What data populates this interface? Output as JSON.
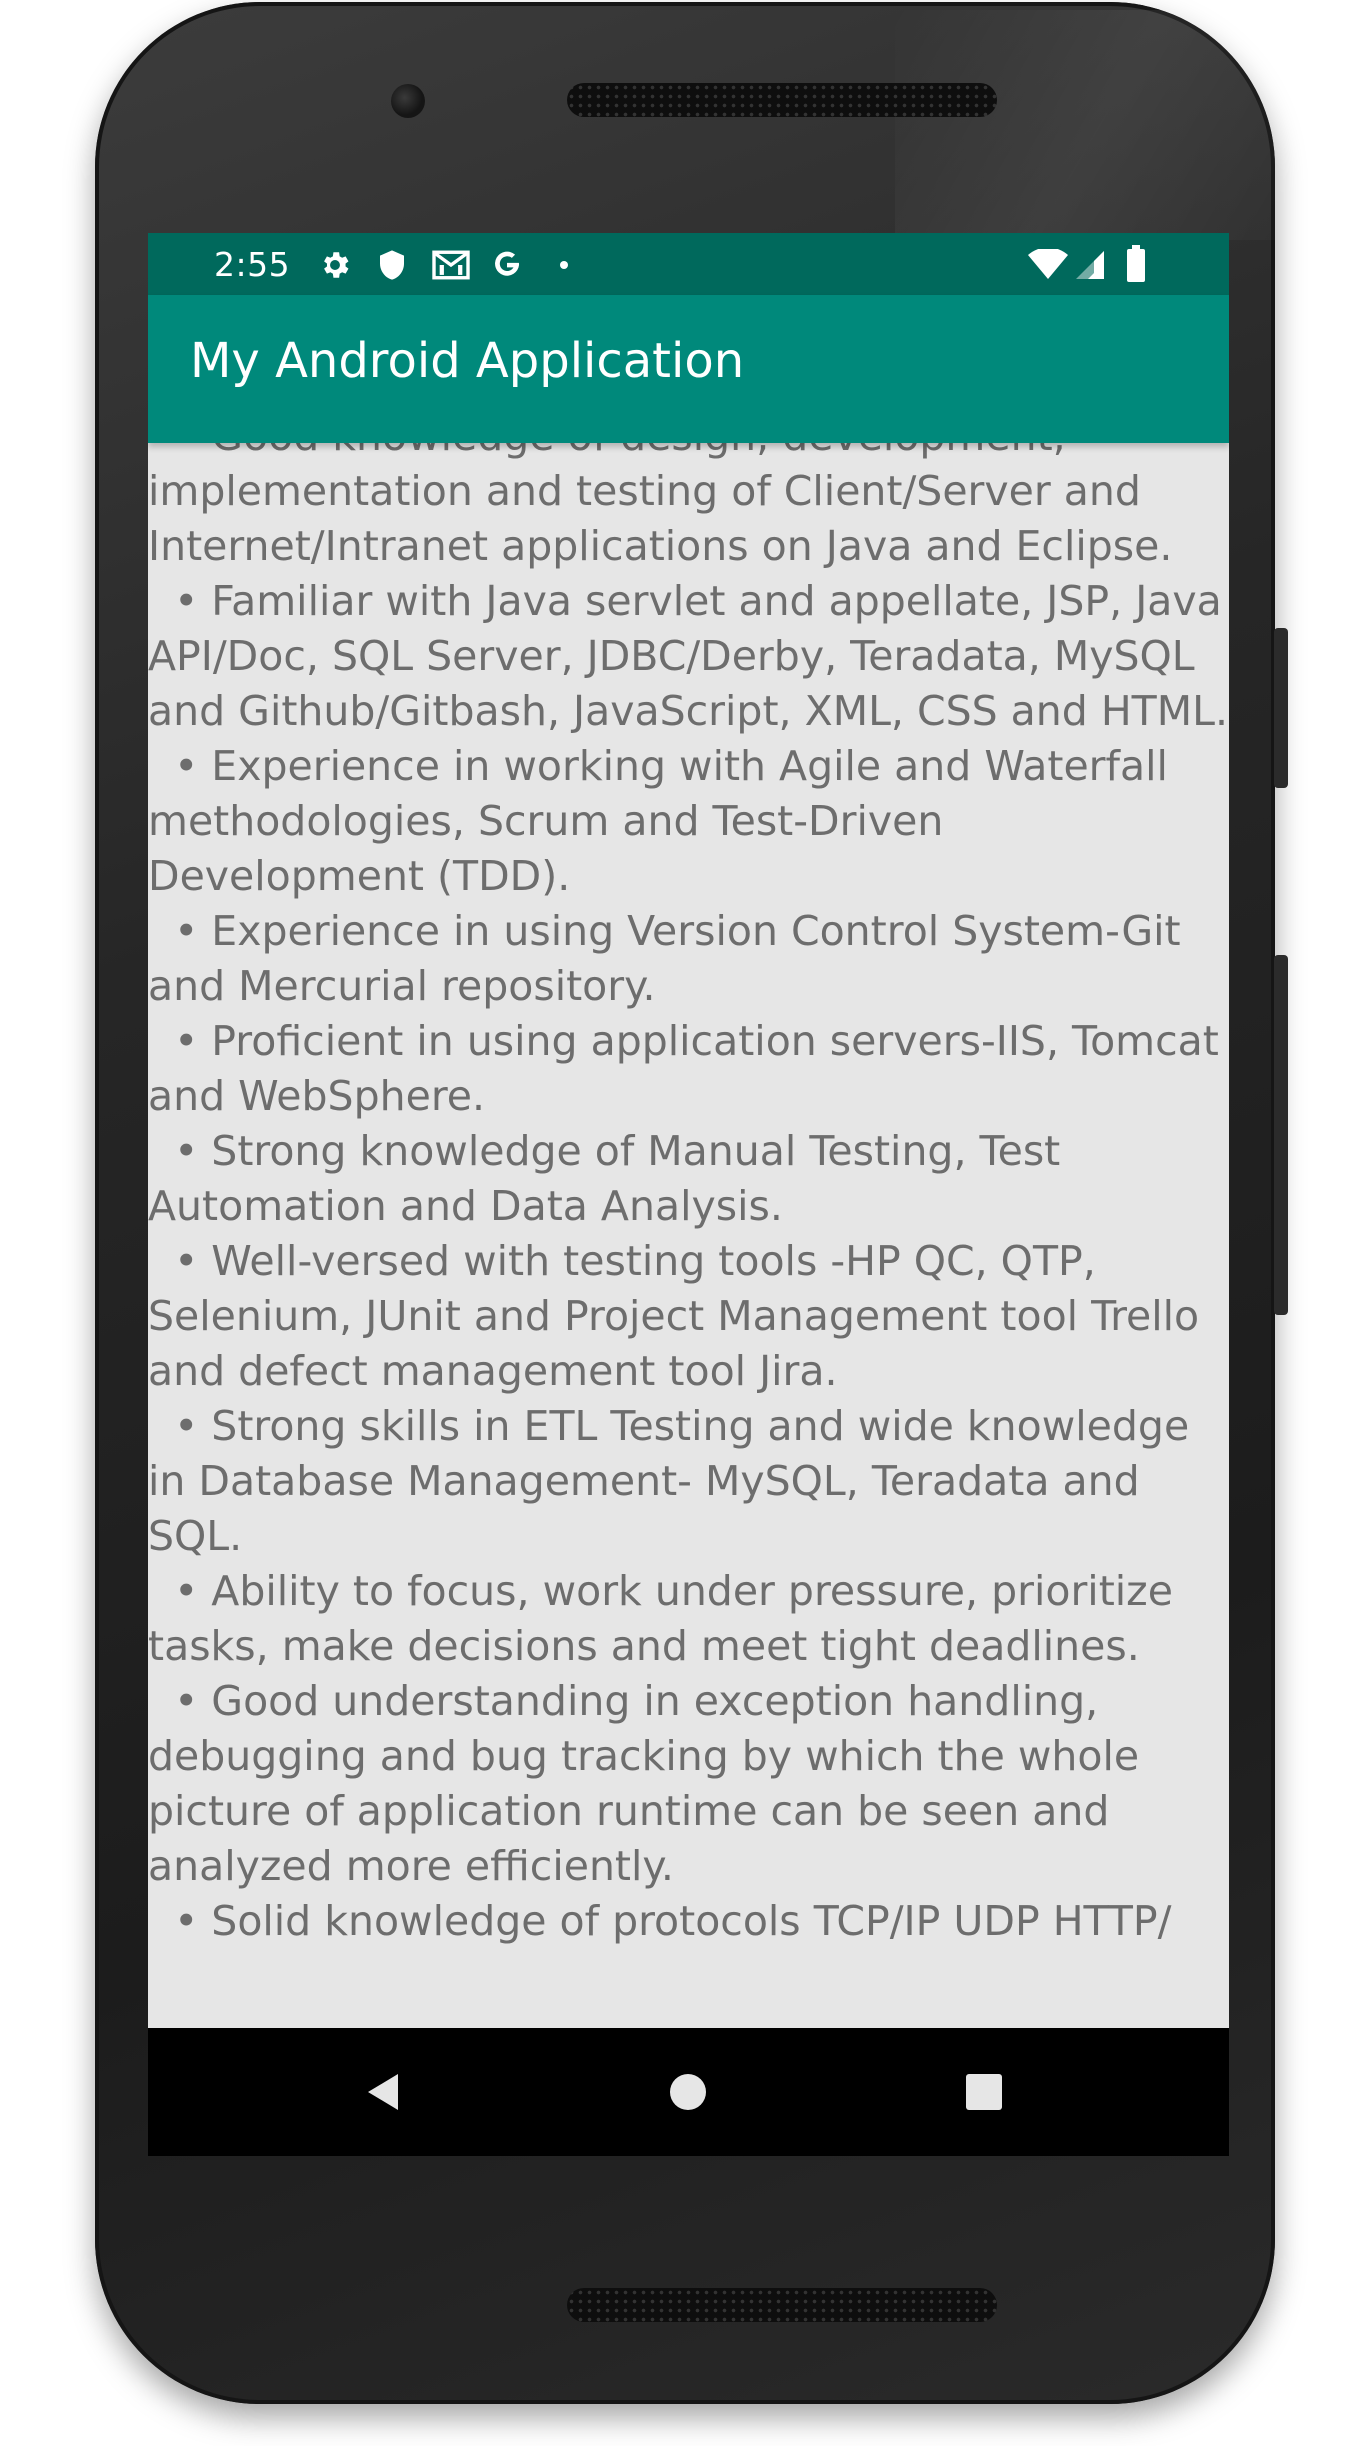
{
  "status_bar": {
    "time": "2:55",
    "left_icons": [
      "gear-icon",
      "shield-icon",
      "mail-icon",
      "google-icon",
      "dot-icon"
    ],
    "right_icons": [
      "wifi-icon",
      "cell-signal-icon",
      "battery-icon"
    ],
    "background_color": "#00695c"
  },
  "app_bar": {
    "title": "My Android Application",
    "background_color": "#00897b"
  },
  "content": {
    "background_color": "#e6e6e6",
    "text_color": "#6d6d6d",
    "body_text": "  • Good knowledge of design, development, implementation and testing of Client/Server and Internet/Intranet applications on Java and Eclipse.\n  • Familiar with Java servlet and appellate, JSP, Java API/Doc, SQL Server, JDBC/Derby, Teradata, MySQL and Github/Gitbash, JavaScript, XML, CSS and HTML.\n  • Experience in working with Agile and Waterfall methodologies, Scrum and Test-Driven Development (TDD).\n  • Experience in using Version Control System-Git and Mercurial repository.\n  • Proficient in using application servers-IIS, Tomcat and WebSphere.\n  • Strong knowledge of Manual Testing, Test Automation and Data Analysis.\n  • Well-versed with testing tools -HP QC, QTP, Selenium, JUnit and Project Management tool Trello and defect management tool Jira.\n  • Strong skills in ETL Testing and wide knowledge in Database Management- MySQL, Teradata and SQL.\n  • Ability to focus, work under pressure, prioritize tasks, make decisions and meet tight deadlines.\n  • Good understanding in exception handling, debugging and bug tracking by which the whole picture of application runtime can be seen and analyzed more efficiently.\n  • Solid knowledge of protocols TCP/IP UDP HTTP/"
  },
  "nav_bar": {
    "buttons": [
      "back-icon",
      "home-icon",
      "recents-icon"
    ]
  }
}
